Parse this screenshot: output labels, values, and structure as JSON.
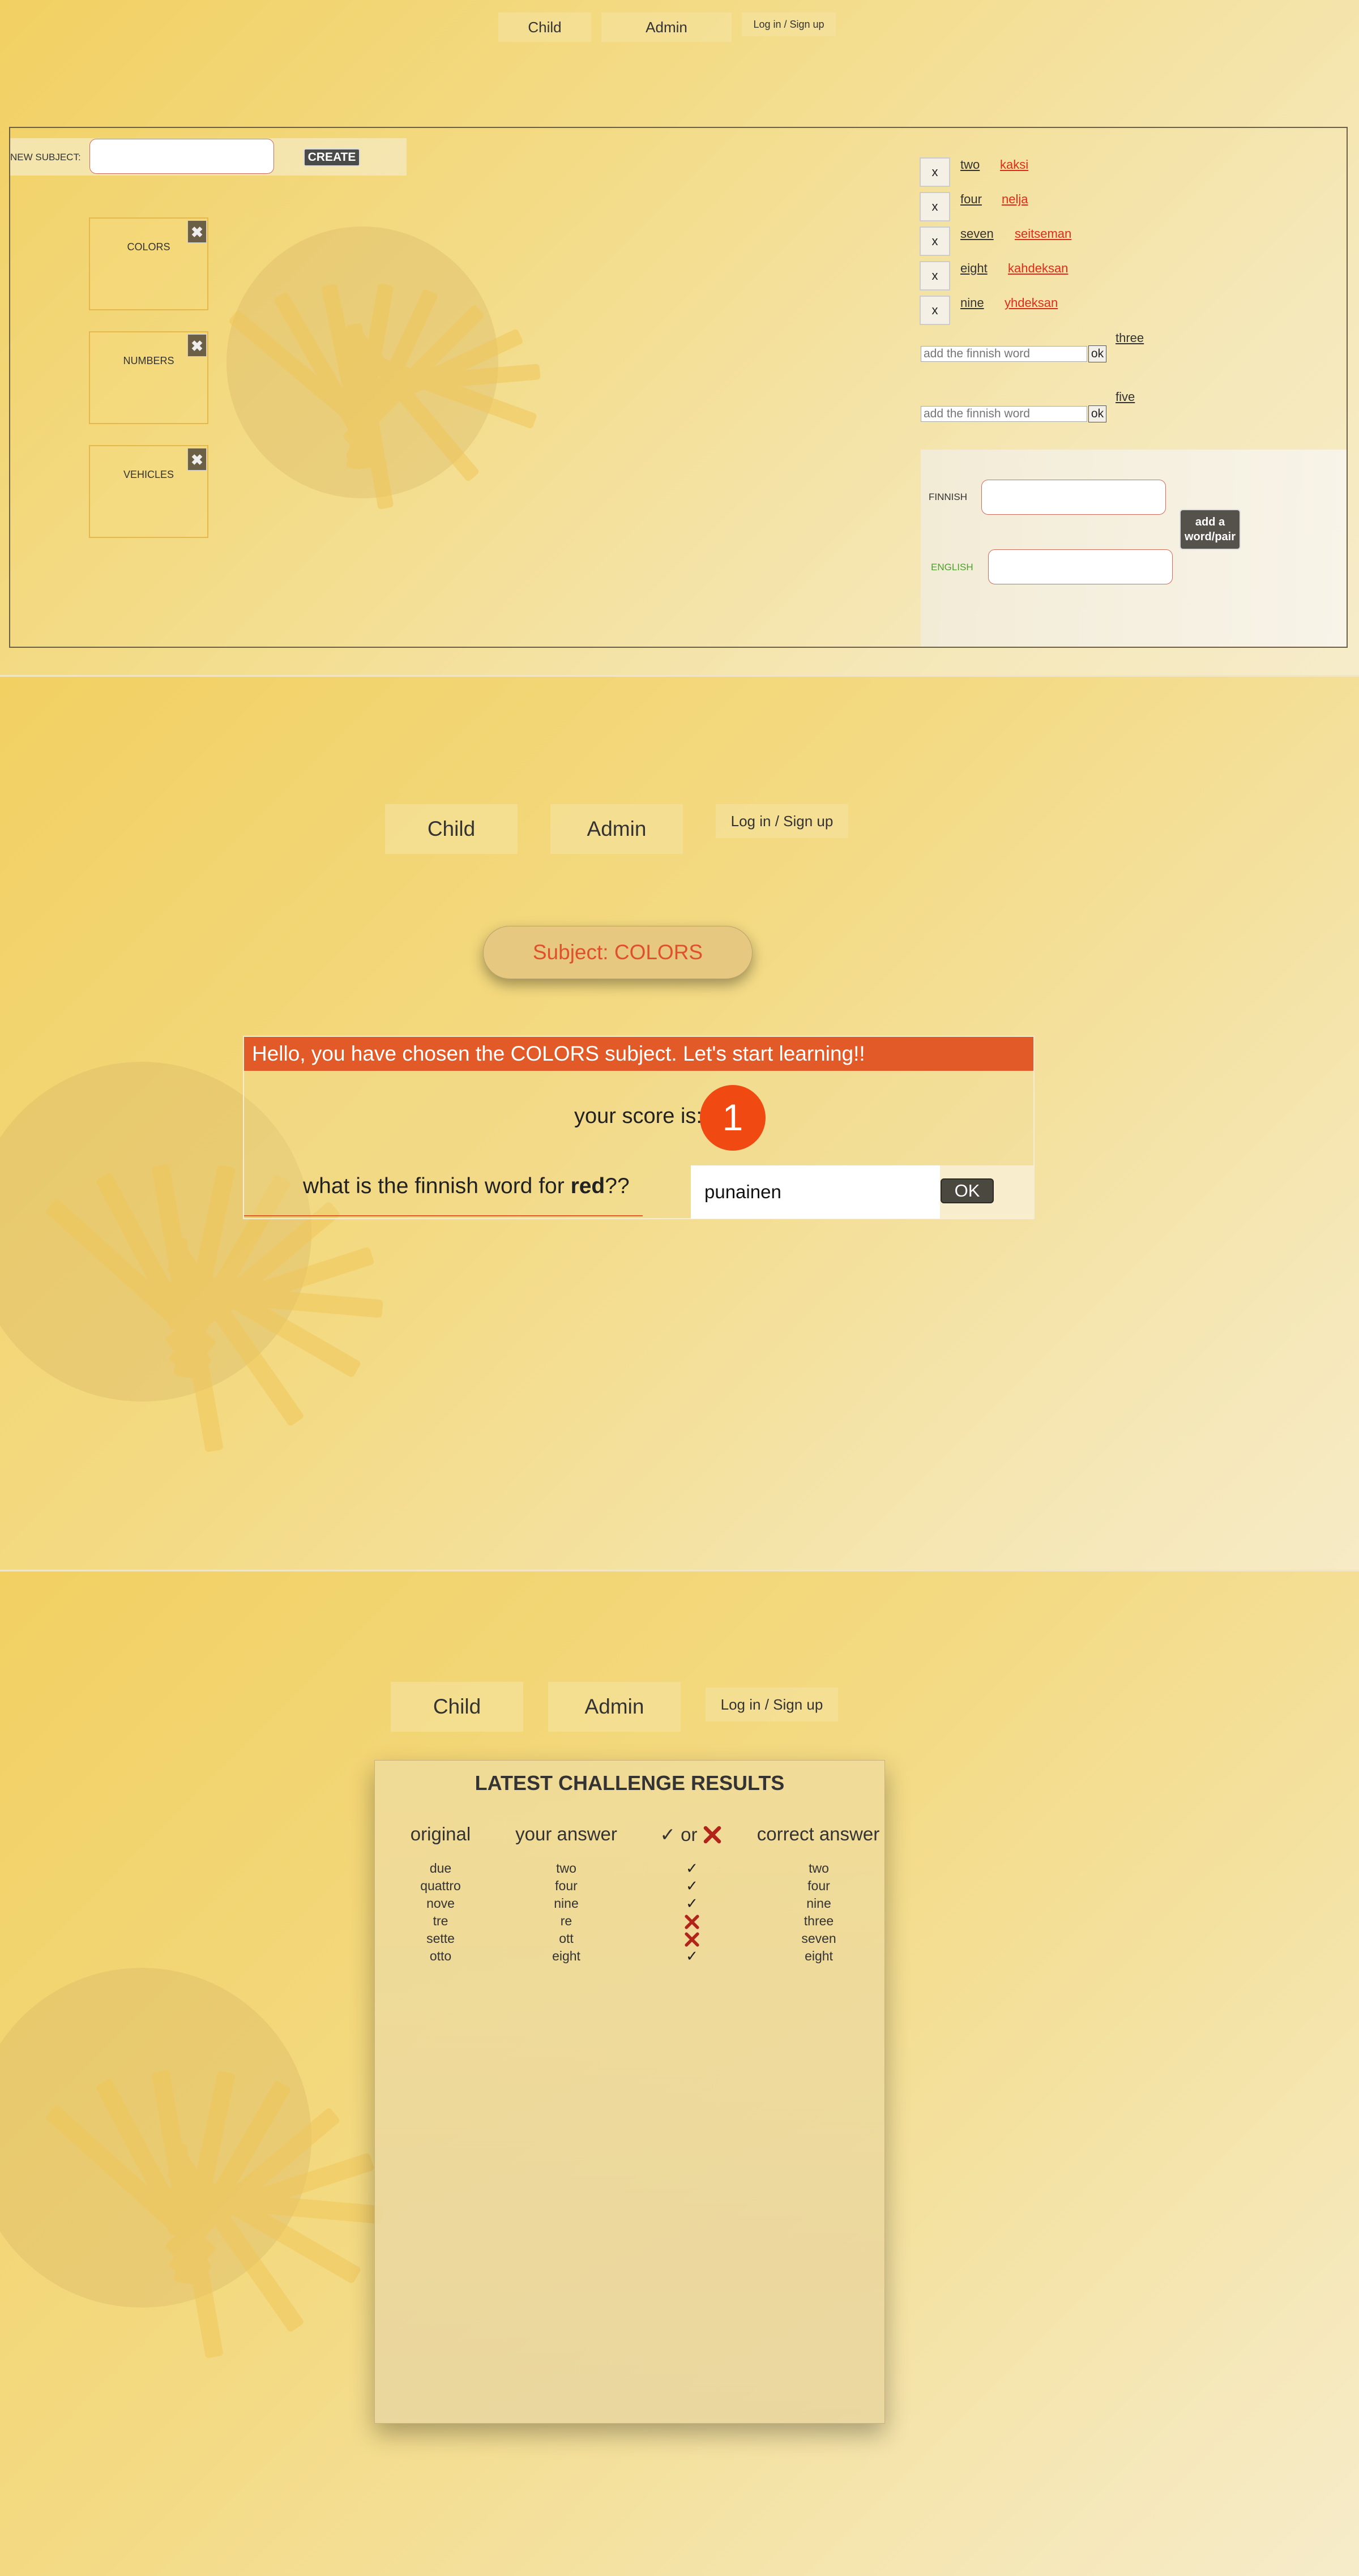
{
  "nav": {
    "child_label": "Child",
    "admin_label": "Admin",
    "login_label": "Log in / Sign up"
  },
  "admin": {
    "new_subject_label": "NEW SUBJECT:",
    "new_subject_value": "",
    "create_label": "CREATE",
    "subjects": [
      {
        "name": "COLORS",
        "delete_symbol": "✖"
      },
      {
        "name": "NUMBERS",
        "delete_symbol": "✖"
      },
      {
        "name": "VEHICLES",
        "delete_symbol": "✖"
      }
    ],
    "pairs": [
      {
        "remove": "x",
        "english": "two",
        "finnish": "kaksi"
      },
      {
        "remove": "x",
        "english": "four",
        "finnish": "nelja"
      },
      {
        "remove": "x",
        "english": "seven",
        "finnish": "seitseman"
      },
      {
        "remove": "x",
        "english": "eight",
        "finnish": "kahdeksan"
      },
      {
        "remove": "x",
        "english": "nine",
        "finnish": "yhdeksan"
      }
    ],
    "missing": [
      {
        "placeholder": "add the finnish word",
        "ok": "ok",
        "english": "three"
      },
      {
        "placeholder": "add the finnish word",
        "ok": "ok",
        "english": "five"
      }
    ],
    "form": {
      "finnish_label": "FINNISH",
      "english_label": "ENGLISH",
      "finnish_value": "",
      "english_value": "",
      "add_line1": "add a",
      "add_line2": "word/pair"
    }
  },
  "learn": {
    "subject_pill": "Subject: COLORS",
    "header": "Hello, you have chosen the COLORS subject. Let's start learning!!",
    "score_label": "your score is:",
    "score": "1",
    "question_prefix": "what is the finnish word for ",
    "question_word": "red",
    "question_suffix": "??",
    "answer_value": "punainen",
    "ok_label": "OK"
  },
  "results": {
    "title": "LATEST CHALLENGE RESULTS",
    "headers": {
      "original": "original",
      "your_answer": "your answer",
      "check_or": "or",
      "correct": "correct answer"
    },
    "rows": [
      {
        "original": "due",
        "answer": "two",
        "correct_flag": true,
        "correct": "two"
      },
      {
        "original": "quattro",
        "answer": "four",
        "correct_flag": true,
        "correct": "four"
      },
      {
        "original": "nove",
        "answer": "nine",
        "correct_flag": true,
        "correct": "nine"
      },
      {
        "original": "tre",
        "answer": "re",
        "correct_flag": false,
        "correct": "three"
      },
      {
        "original": "sette",
        "answer": "ott",
        "correct_flag": false,
        "correct": "seven"
      },
      {
        "original": "otto",
        "answer": "eight",
        "correct_flag": true,
        "correct": "eight"
      }
    ],
    "check_symbol": "✓"
  },
  "colors": {
    "accent_orange": "#e35a29",
    "score_orange": "#f04a12",
    "finnish_red": "#e02a1a",
    "wrong_red": "#b2231a",
    "english_green": "#4aa02a"
  }
}
